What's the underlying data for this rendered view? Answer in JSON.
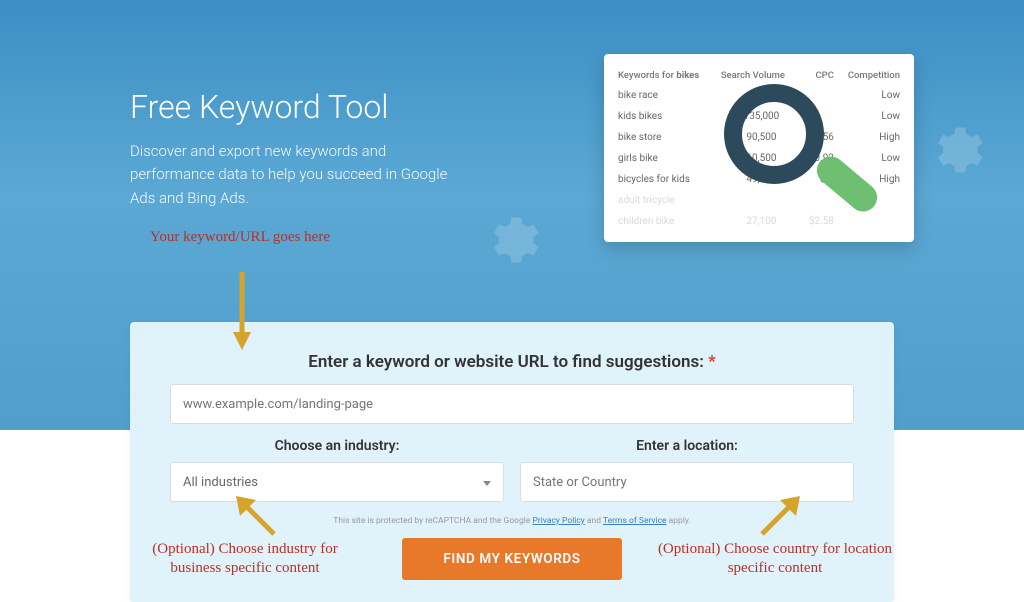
{
  "hero": {
    "title": "Free Keyword Tool",
    "subtitle": "Discover and export new keywords and performance data to help you succeed in Google Ads and Bing Ads."
  },
  "preview": {
    "header_keywords_prefix": "Keywords for ",
    "header_keywords_term": "bikes",
    "header_volume": "Search Volume",
    "header_cpc": "CPC",
    "header_comp": "Competition",
    "rows": [
      {
        "kw": "bike race",
        "vol": "",
        "cpc": "",
        "comp": "Low",
        "faded": false
      },
      {
        "kw": "kids bikes",
        "vol": "135,000",
        "cpc": "",
        "comp": "Low",
        "faded": false
      },
      {
        "kw": "bike store",
        "vol": "90,500",
        "cpc": "$0.56",
        "comp": "High",
        "faded": false
      },
      {
        "kw": "girls bike",
        "vol": "60,500",
        "cpc": "$0.92",
        "comp": "Low",
        "faded": false
      },
      {
        "kw": "bicycles for kids",
        "vol": "49,500",
        "cpc": "$1.",
        "comp": "High",
        "faded": false
      },
      {
        "kw": "adult tricycle",
        "vol": "",
        "cpc": "",
        "comp": "",
        "faded": true
      },
      {
        "kw": "children bike",
        "vol": "27,100",
        "cpc": "$2.58",
        "comp": "",
        "faded": true
      }
    ]
  },
  "form": {
    "title": "Enter a keyword or website URL to find suggestions:",
    "keyword_placeholder": "www.example.com/landing-page",
    "industry_label": "Choose an industry:",
    "industry_value": "All industries",
    "location_label": "Enter a location:",
    "location_placeholder": "State or Country",
    "disclaimer_prefix": "This site is protected by reCAPTCHA and the Google ",
    "privacy": "Privacy Policy",
    "and": " and ",
    "tos": "Terms of Service",
    "disclaimer_suffix": " apply.",
    "submit": "FIND MY KEYWORDS"
  },
  "annotations": {
    "a1": "Your keyword/URL goes here",
    "a2": "(Optional) Choose industry for business specific content",
    "a3": "(Optional) Choose country for location specific content"
  },
  "colors": {
    "arrow": "#d6a42a"
  }
}
